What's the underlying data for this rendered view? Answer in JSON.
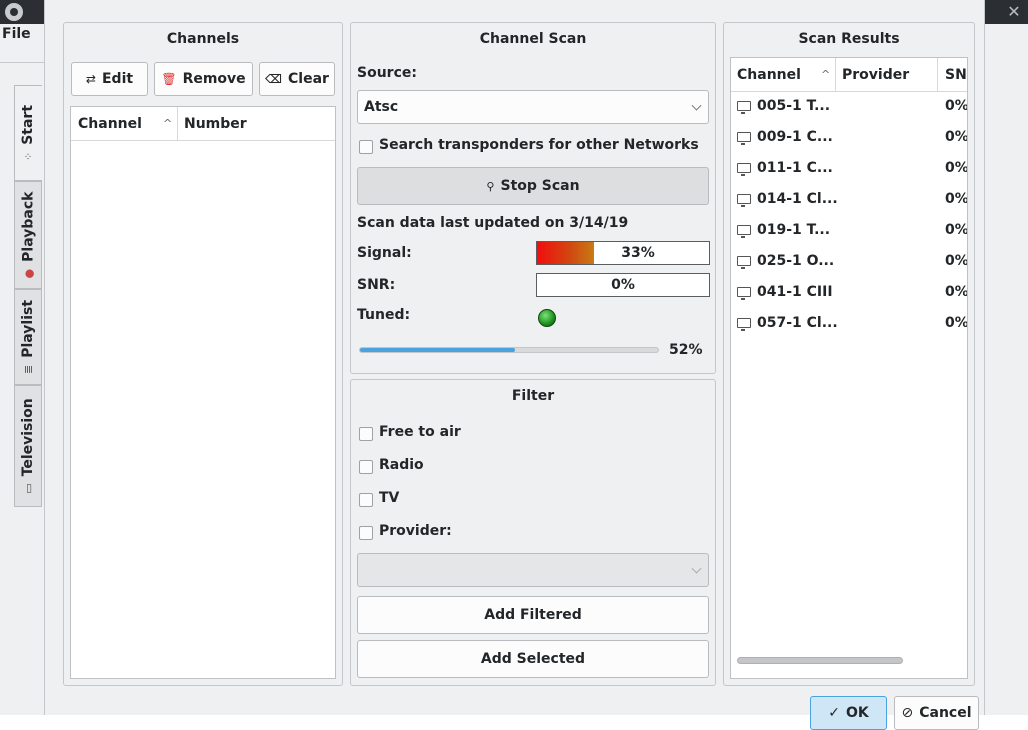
{
  "background_window": {
    "menu_file": "File"
  },
  "vertical_tabs": [
    {
      "label": "Start",
      "icon": "sparkle-icon",
      "glyph": "⁘",
      "active": true
    },
    {
      "label": "Playback",
      "icon": "record-icon",
      "glyph": "●",
      "active": false
    },
    {
      "label": "Playlist",
      "icon": "list-icon",
      "glyph": "≣",
      "active": false
    },
    {
      "label": "Television",
      "icon": "tv-icon",
      "glyph": "▭",
      "active": false
    }
  ],
  "channels": {
    "title": "Channels",
    "edit_label": "Edit",
    "remove_label": "Remove",
    "clear_label": "Clear",
    "col_channel": "Channel",
    "col_number": "Number"
  },
  "scan": {
    "title": "Channel Scan",
    "source_label": "Source:",
    "source_value": "Atsc",
    "search_transponders": "Search transponders for other Networks",
    "stop_scan_label": "Stop Scan",
    "last_updated": "Scan data last updated on 3/14/19",
    "signal_label": "Signal:",
    "signal_value": "33%",
    "signal_fraction": 0.33,
    "snr_label": "SNR:",
    "snr_value": "0%",
    "tuned_label": "Tuned:",
    "progress_text": "52%",
    "progress_fraction": 0.52
  },
  "filter": {
    "title": "Filter",
    "free_to_air": "Free to air",
    "radio": "Radio",
    "tv": "TV",
    "provider": "Provider:",
    "add_filtered": "Add Filtered",
    "add_selected": "Add Selected"
  },
  "results": {
    "title": "Scan Results",
    "col_channel": "Channel",
    "col_provider": "Provider",
    "col_snr": "SN",
    "rows": [
      {
        "channel": "005-1 T...",
        "snr": "0%"
      },
      {
        "channel": "009-1 C...",
        "snr": "0%"
      },
      {
        "channel": "011-1 C...",
        "snr": "0%"
      },
      {
        "channel": "014-1 Cl...",
        "snr": "0%"
      },
      {
        "channel": "019-1 T...",
        "snr": "0%"
      },
      {
        "channel": "025-1 O...",
        "snr": "0%"
      },
      {
        "channel": "041-1 CIII",
        "snr": "0%"
      },
      {
        "channel": "057-1 Cl...",
        "snr": "0%"
      }
    ]
  },
  "footer": {
    "ok_label": "OK",
    "cancel_label": "Cancel"
  },
  "colors": {
    "tuned_led": "#28a428",
    "progress": "#4aa3df"
  }
}
